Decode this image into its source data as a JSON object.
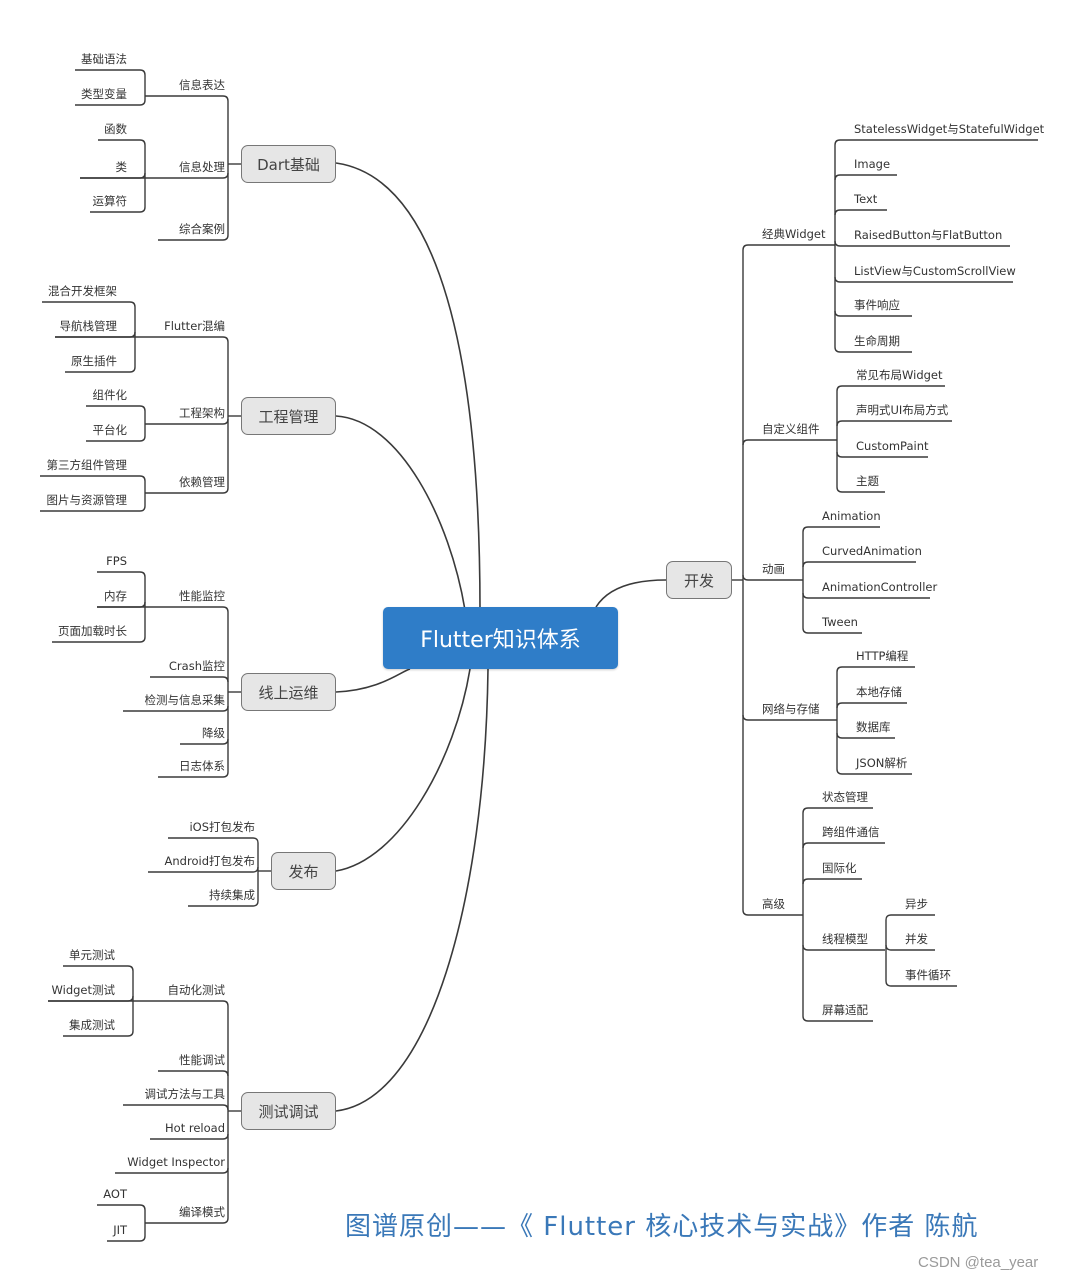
{
  "root": {
    "label": "Flutter知识体系",
    "color": "#2f7dc8"
  },
  "branches": {
    "dart": {
      "label": "Dart基础",
      "children": [
        {
          "label": "信息表达",
          "children": [
            "基础语法",
            "类型变量"
          ]
        },
        {
          "label": "信息处理",
          "children": [
            "函数",
            "类",
            "运算符"
          ]
        },
        {
          "label": "综合案例",
          "children": []
        }
      ]
    },
    "engineering": {
      "label": "工程管理",
      "children": [
        {
          "label": "Flutter混编",
          "children": [
            "混合开发框架",
            "导航栈管理",
            "原生插件"
          ]
        },
        {
          "label": "工程架构",
          "children": [
            "组件化",
            "平台化"
          ]
        },
        {
          "label": "依赖管理",
          "children": [
            "第三方组件管理",
            "图片与资源管理"
          ]
        }
      ]
    },
    "ops": {
      "label": "线上运维",
      "children": [
        {
          "label": "性能监控",
          "children": [
            "FPS",
            "内存",
            "页面加载时长"
          ]
        },
        {
          "label": "Crash监控",
          "children": []
        },
        {
          "label": "检测与信息采集",
          "children": []
        },
        {
          "label": "降级",
          "children": []
        },
        {
          "label": "日志体系",
          "children": []
        }
      ]
    },
    "release": {
      "label": "发布",
      "children": [
        {
          "label": "iOS打包发布",
          "children": []
        },
        {
          "label": "Android打包发布",
          "children": []
        },
        {
          "label": "持续集成",
          "children": []
        }
      ]
    },
    "testing": {
      "label": "测试调试",
      "children": [
        {
          "label": "自动化测试",
          "children": [
            "单元测试",
            "Widget测试",
            "集成测试"
          ]
        },
        {
          "label": "性能调试",
          "children": []
        },
        {
          "label": "调试方法与工具",
          "children": []
        },
        {
          "label": "Hot reload",
          "children": []
        },
        {
          "label": "Widget Inspector",
          "children": []
        },
        {
          "label": "编译模式",
          "children": [
            "AOT",
            "JIT"
          ]
        }
      ]
    },
    "dev": {
      "label": "开发",
      "children": [
        {
          "label": "经典Widget",
          "children": [
            {
              "label": "StatelessWidget与StatefulWidget"
            },
            {
              "label": "Image"
            },
            {
              "label": "Text"
            },
            {
              "label": "RaisedButton与FlatButton"
            },
            {
              "label": "ListView与CustomScrollView"
            },
            {
              "label": "事件响应"
            },
            {
              "label": "生命周期"
            }
          ]
        },
        {
          "label": "自定义组件",
          "children": [
            {
              "label": "常见布局Widget"
            },
            {
              "label": "声明式UI布局方式"
            },
            {
              "label": "CustomPaint"
            },
            {
              "label": "主题"
            }
          ]
        },
        {
          "label": "动画",
          "children": [
            {
              "label": "Animation"
            },
            {
              "label": "CurvedAnimation"
            },
            {
              "label": "AnimationController"
            },
            {
              "label": "Tween"
            }
          ]
        },
        {
          "label": "网络与存储",
          "children": [
            {
              "label": "HTTP编程"
            },
            {
              "label": "本地存储"
            },
            {
              "label": "数据库"
            },
            {
              "label": "JSON解析"
            }
          ]
        },
        {
          "label": "高级",
          "children": [
            {
              "label": "状态管理"
            },
            {
              "label": "跨组件通信"
            },
            {
              "label": "国际化"
            },
            {
              "label": "线程模型",
              "children": [
                "异步",
                "并发",
                "事件循环"
              ]
            },
            {
              "label": "屏幕适配"
            }
          ]
        }
      ]
    }
  },
  "footer": {
    "credit": "图谱原创——《 Flutter 核心技术与实战》作者 陈航",
    "color": "#3a78b8"
  },
  "watermark": "CSDN @tea_year"
}
